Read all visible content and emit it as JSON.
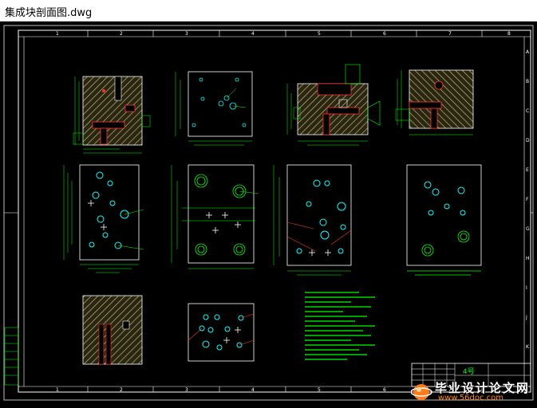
{
  "window": {
    "title": "集成块剖面图.dwg"
  },
  "border": {
    "top_numbers": [
      "1",
      "2",
      "3",
      "4",
      "5",
      "6",
      "7",
      "8"
    ],
    "bottom_numbers": [
      "1",
      "2",
      "3",
      "4",
      "5",
      "6",
      "7",
      "8"
    ],
    "side_letters": [
      "A",
      "B",
      "C",
      "D",
      "E",
      "F",
      "G",
      "H",
      "I",
      "J",
      "K"
    ]
  },
  "title_block": {
    "label": "4号"
  },
  "watermark": {
    "site_name": "毕业设计论文网",
    "url": "www.56doc.com"
  },
  "colors": {
    "frame": "#ffffff",
    "outline": "#ffffff",
    "dimension": "#00ff00",
    "hatch": "#ffff66",
    "holes": "#00ffff",
    "cut": "#ff3030",
    "text": "#00ff00"
  }
}
